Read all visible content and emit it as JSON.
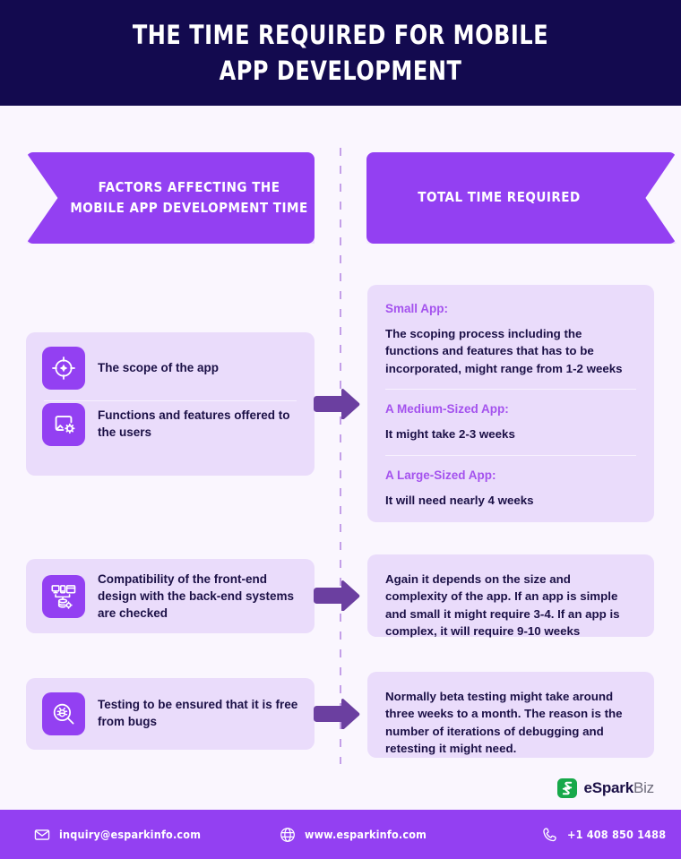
{
  "header": {
    "title": "THE TIME REQUIRED FOR MOBILE\nAPP DEVELOPMENT",
    "background_color": "#130A4F",
    "text_color": "#FFFFFF"
  },
  "theme": {
    "page_background": "#FAF6FE",
    "accent_purple": "#9340F2",
    "card_background": "#EADCFB",
    "heading_purple": "#A452EE",
    "body_navy": "#1B1046",
    "arrow_purple": "#6B3FA0",
    "divider_purple": "#C49FE8"
  },
  "banners": {
    "left": {
      "label": "FACTORS AFFECTING THE\nMOBILE APP DEVELOPMENT TIME",
      "notch": "left"
    },
    "right": {
      "label": "TOTAL TIME REQUIRED",
      "notch": "right"
    }
  },
  "factors": [
    {
      "rows": [
        {
          "icon": "target-crosshair-icon",
          "text": "The scope of the app"
        },
        {
          "icon": "screen-gear-icon",
          "text": "Functions and features offered to the users"
        }
      ]
    },
    {
      "rows": [
        {
          "icon": "devices-database-network-icon",
          "text": "Compatibility of the front-end design with the back-end systems are checked"
        }
      ]
    },
    {
      "rows": [
        {
          "icon": "magnifier-bug-icon",
          "text": "Testing to be ensured that it is free from bugs"
        }
      ]
    }
  ],
  "times": [
    {
      "blocks": [
        {
          "heading": "Small App:",
          "body": "The scoping process including the functions and features that has to be incorporated, might range from 1-2 weeks"
        },
        {
          "heading": "A Medium-Sized App:",
          "body": "It might take 2-3 weeks"
        },
        {
          "heading": "A Large-Sized App:",
          "body": "It will need nearly 4 weeks"
        }
      ]
    },
    {
      "blocks": [
        {
          "heading": "",
          "body": "Again it depends on the size and complexity of the app. If an app is simple and small it might require 3-4. If an app is complex, it will require 9-10 weeks"
        }
      ]
    },
    {
      "blocks": [
        {
          "heading": "",
          "body": "Normally beta testing might take around three weeks to a month. The reason is the number of iterations of debugging and retesting it might need."
        }
      ]
    }
  ],
  "arrows": [
    {
      "name": "arrow-right-icon"
    },
    {
      "name": "arrow-right-icon"
    },
    {
      "name": "arrow-right-icon"
    }
  ],
  "brand": {
    "icon": "esparkbiz-logo-icon",
    "name_bold": "eSpark",
    "name_light": "Biz",
    "mark_color": "#17A84A"
  },
  "footer": {
    "items": [
      {
        "icon": "envelope-icon",
        "text": "inquiry@esparkinfo.com"
      },
      {
        "icon": "globe-icon",
        "text": "www.esparkinfo.com"
      },
      {
        "icon": "phone-icon",
        "text": "+1 408 850 1488"
      }
    ]
  }
}
